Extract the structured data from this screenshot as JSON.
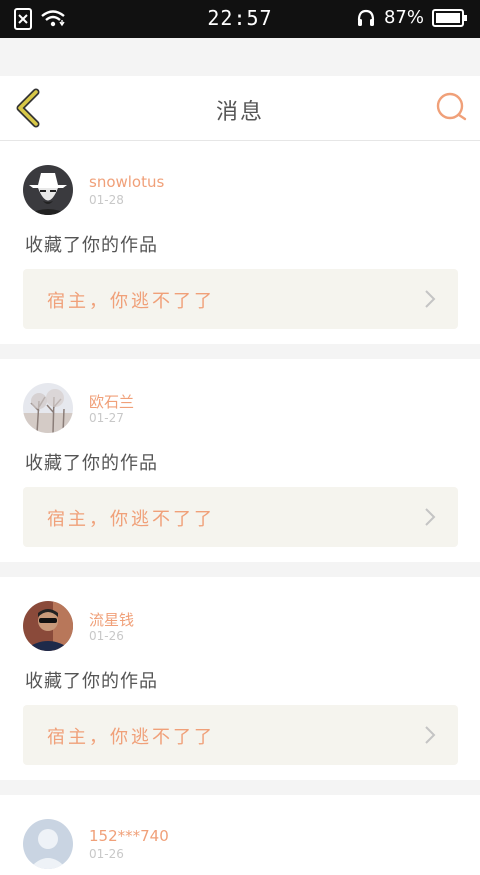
{
  "status_bar": {
    "time": "22:57",
    "battery": "87%",
    "icons": [
      "sim-x-icon",
      "wifi-icon",
      "headset-icon",
      "battery-icon"
    ]
  },
  "header": {
    "title": "消息",
    "back_icon": "chevron-left-icon",
    "search_icon": "search-icon"
  },
  "colors": {
    "accent": "#f0a079",
    "back_chevron": "#d8c848",
    "work_bg": "#f5f4ee"
  },
  "messages": [
    {
      "user": "snowlotus",
      "date": "01-28",
      "action": "收藏了你的作品",
      "work_title": "宿主，你逃不了了"
    },
    {
      "user": "欧石兰",
      "date": "01-27",
      "action": "收藏了你的作品",
      "work_title": "宿主，你逃不了了"
    },
    {
      "user": "流星钱",
      "date": "01-26",
      "action": "收藏了你的作品",
      "work_title": "宿主，你逃不了了"
    },
    {
      "user": "152***740",
      "date": "01-26"
    }
  ]
}
